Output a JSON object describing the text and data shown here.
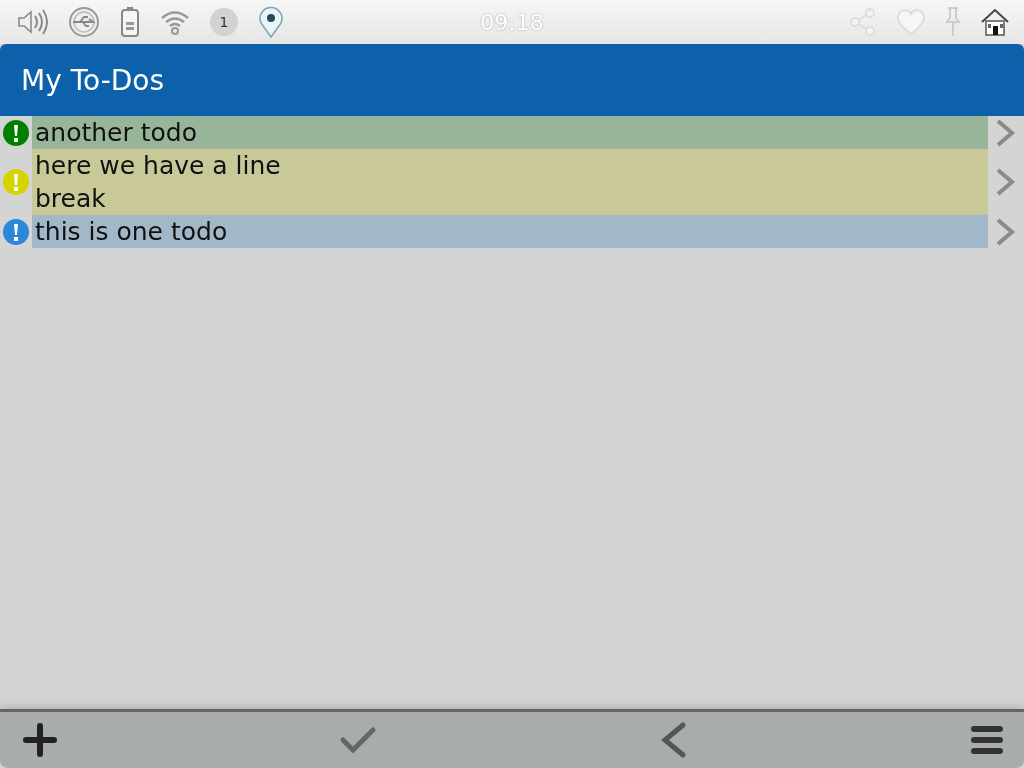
{
  "status_bar": {
    "notification_count": "1",
    "time": "09:18"
  },
  "header": {
    "title": "My To-Dos"
  },
  "todos": [
    {
      "text": "another todo",
      "color": "#008000"
    },
    {
      "text": "here we have a line\nbreak",
      "color": "#d4d400"
    },
    {
      "text": "this is one todo",
      "color": "#2b88d8"
    }
  ]
}
